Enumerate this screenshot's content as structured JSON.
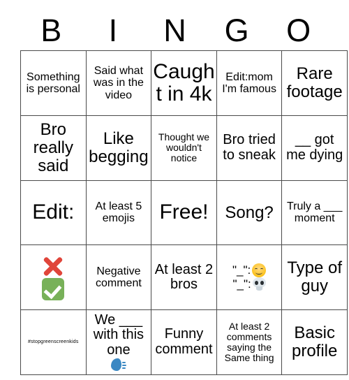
{
  "card": {
    "header_letters": [
      "B",
      "I",
      "N",
      "G",
      "O"
    ],
    "rows": [
      [
        {
          "text": "Something is personal",
          "size": "fs-sm"
        },
        {
          "text": "Said what was in the video",
          "size": "fs-sm"
        },
        {
          "text": "Caught in 4k",
          "size": "fs-xl"
        },
        {
          "text": "Edit:mom I'm famous",
          "size": "fs-sm"
        },
        {
          "text": "Rare footage",
          "size": "fs-lg"
        }
      ],
      [
        {
          "text": "Bro really said",
          "size": "fs-lg"
        },
        {
          "text": "Like begging",
          "size": "fs-lg"
        },
        {
          "text": "Thought we wouldn't notice",
          "size": "fs-xs"
        },
        {
          "text": "Bro tried to sneak",
          "size": "fs-md"
        },
        {
          "text": "__ got me dying",
          "size": "fs-md"
        }
      ],
      [
        {
          "text": "Edit:",
          "size": "fs-xl"
        },
        {
          "text": "At least 5 emojis",
          "size": "fs-sm"
        },
        {
          "text": "Free!",
          "size": "fs-xl"
        },
        {
          "text": "Song?",
          "size": "fs-lg"
        },
        {
          "text": "Truly a ___ moment",
          "size": "fs-sm"
        }
      ],
      [
        {
          "text": "",
          "size": "fs-md",
          "icons": [
            "cross-mark",
            "check-mark"
          ]
        },
        {
          "text": "Negative comment",
          "size": "fs-sm"
        },
        {
          "text": "At least 2 bros",
          "size": "fs-md"
        },
        {
          "text": "\"_\":  \"_\":",
          "size": "fs-sm",
          "emoji_lines": [
            {
              "label": "\"_\":",
              "emoji": "smiling-face"
            },
            {
              "label": "\"_\":",
              "emoji": "skull"
            }
          ]
        },
        {
          "text": "Type of guy",
          "size": "fs-lg"
        }
      ],
      [
        {
          "text": "#stopgreenscreenkids",
          "size": "fs-tiny"
        },
        {
          "text": "We ___ with this one",
          "size": "fs-md",
          "trailing_emoji": "speaking-head"
        },
        {
          "text": "Funny comment",
          "size": "fs-md"
        },
        {
          "text": "At least 2 comments saying the Same thing",
          "size": "fs-xs"
        },
        {
          "text": "Basic profile",
          "size": "fs-lg"
        }
      ]
    ],
    "emoji_labels": {
      "line1": "\"_\":",
      "line2": "\"_\":"
    },
    "colors": {
      "border": "#4a4a4a",
      "text": "#000000",
      "background": "#ffffff",
      "cross_red": "#e0453a",
      "check_green": "#78b159",
      "speak_blue": "#3b88c3",
      "smiley_yellow": "#fcc21b",
      "skull_grey": "#e1e8ed"
    }
  }
}
